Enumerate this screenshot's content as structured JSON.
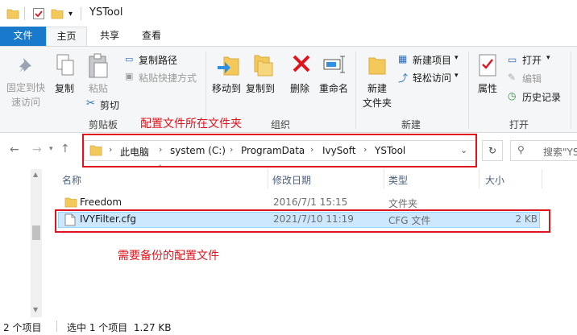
{
  "window": {
    "title": "YSTool"
  },
  "tabs": [
    {
      "label": "文件"
    },
    {
      "label": "主页"
    },
    {
      "label": "共享"
    },
    {
      "label": "查看"
    }
  ],
  "ribbon": {
    "pin_label_1": "固定到快",
    "pin_label_2": "速访问",
    "copy_label": "复制",
    "paste_label": "粘贴",
    "copy_path_label": "复制路径",
    "paste_shortcut_label": "粘贴快捷方式",
    "cut_label": "剪切",
    "clipboard_group": "剪贴板",
    "move_to_label": "移动到",
    "copy_to_label": "复制到",
    "delete_label": "删除",
    "rename_label": "重命名",
    "organize_group": "组织",
    "new_folder_label_1": "新建",
    "new_folder_label_2": "文件夹",
    "new_item_label": "新建项目",
    "easy_access_label": "轻松访问",
    "new_group": "新建",
    "properties_label": "属性",
    "open_label": "打开",
    "edit_label": "编辑",
    "history_label": "历史记录",
    "open_group": "打开"
  },
  "address": {
    "crumbs": [
      "此电脑",
      "system (C:)",
      "ProgramData",
      "IvySoft",
      "YSTool"
    ],
    "search_placeholder": "搜索\"YS"
  },
  "columns": {
    "name": "名称",
    "modified": "修改日期",
    "type": "类型",
    "size": "大小"
  },
  "files": [
    {
      "name": "Freedom",
      "modified": "2016/7/1 15:15",
      "type": "文件夹",
      "size": ""
    },
    {
      "name": "IVYFilter.cfg",
      "modified": "2021/7/10 11:19",
      "type": "CFG 文件",
      "size": "2 KB"
    }
  ],
  "status": {
    "count": "2 个项目",
    "selection": "选中 1 个项目  1.27 KB"
  },
  "annotations": {
    "folder_note": "配置文件所在文件夹",
    "file_note": "需要备份的配置文件"
  },
  "colors": {
    "annotation": "#e0141d",
    "file_tab": "#1979ca",
    "selection": "#cce8ff"
  }
}
